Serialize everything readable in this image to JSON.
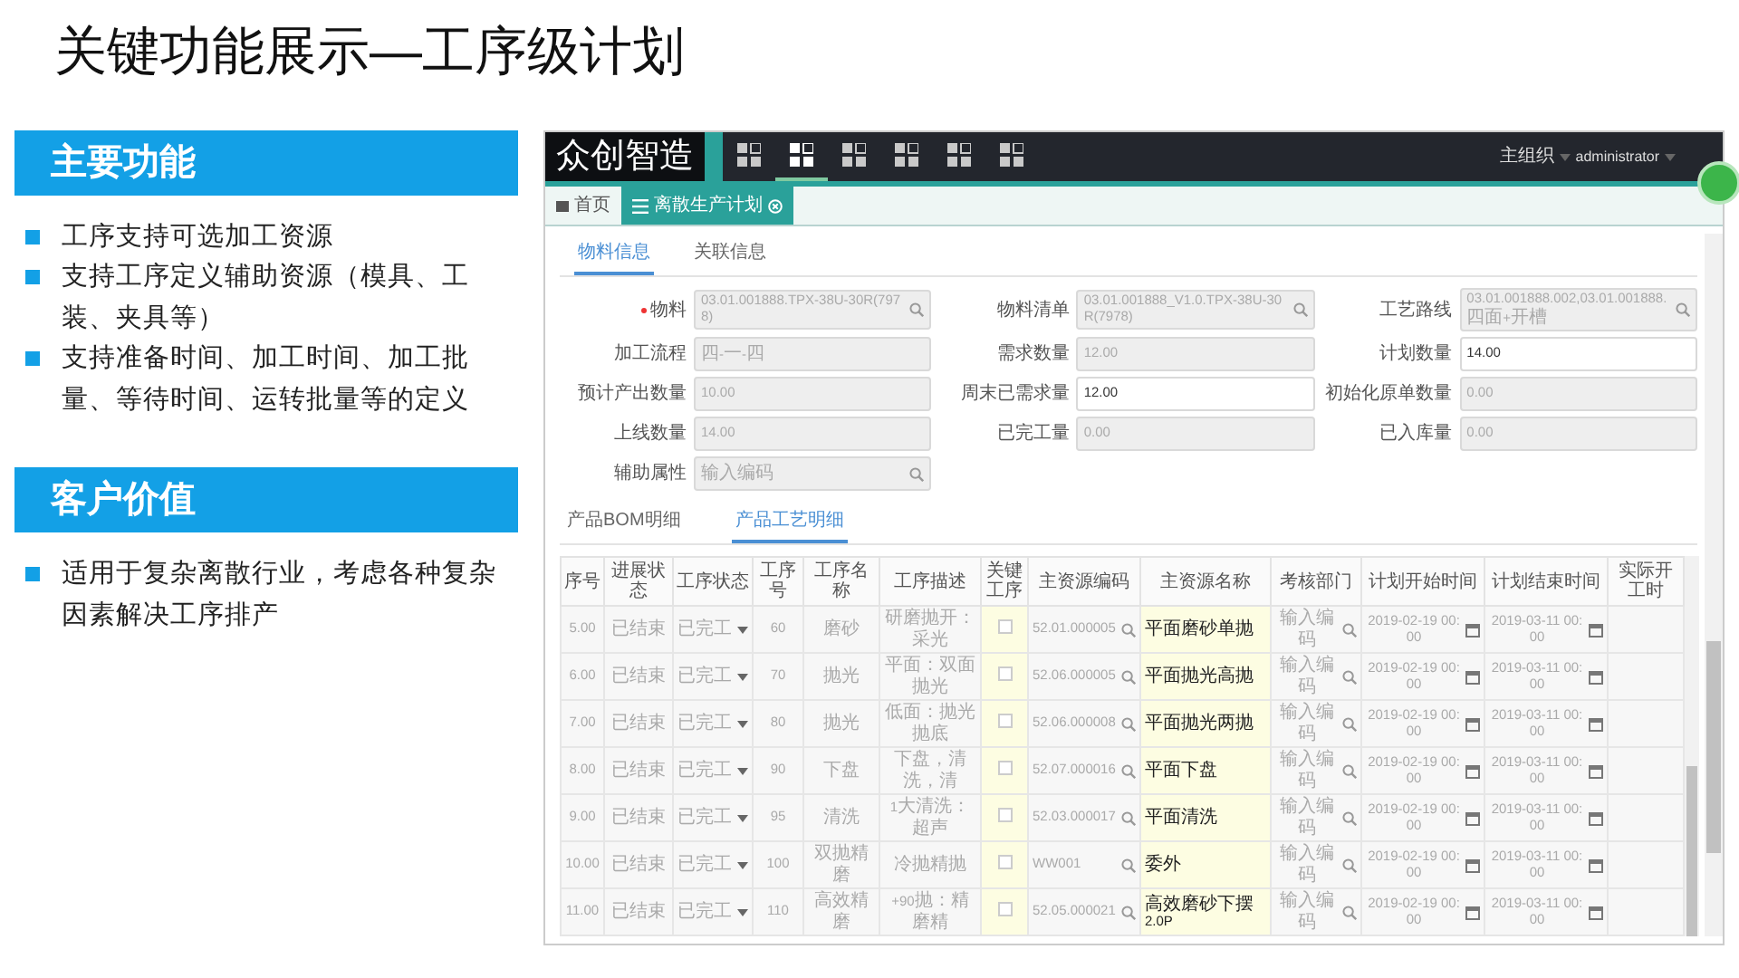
{
  "slide_title": "关键功能展示—工序级计划",
  "sections": [
    {
      "heading": "主要功能",
      "items": [
        "工序支持可选加工资源",
        "支持工序定义辅助资源（模具、工装、夹具等）",
        "支持准备时间、加工时间、加工批量、等待时间、运转批量等的定义"
      ]
    },
    {
      "heading": "客户价值",
      "items": [
        "适用于复杂离散行业，考虑各种复杂因素解决工序排产"
      ]
    }
  ],
  "app": {
    "logo": "众创智造",
    "nav_icons": [
      {
        "selected": false
      },
      {
        "selected": true
      },
      {
        "selected": false
      },
      {
        "selected": false
      },
      {
        "selected": false
      },
      {
        "selected": false
      }
    ],
    "org": "主组织",
    "user": "administrator",
    "tabs": [
      {
        "label": "首页",
        "kind": "home",
        "selected": false
      },
      {
        "label": "离散生产计划",
        "kind": "menu",
        "selected": true
      }
    ],
    "detail_tabs": [
      {
        "label": "物料信息",
        "selected": true
      },
      {
        "label": "关联信息",
        "selected": false
      }
    ],
    "form_rows": [
      [
        {
          "label": "物料",
          "required": true,
          "value": "03.01.001888.TPX-38U-30R(7978)",
          "readonly": true,
          "lookup": true
        },
        {
          "label": "物料清单",
          "required": false,
          "value": "03.01.001888_V1.0.TPX-38U-30R(7978)",
          "readonly": true,
          "lookup": true
        },
        {
          "label": "工艺路线",
          "required": false,
          "value": "03.01.001888.002,03.01.001888.四面+开槽",
          "readonly": true,
          "lookup": true
        }
      ],
      [
        {
          "label": "加工流程",
          "required": false,
          "value": "四-一-四",
          "readonly": true,
          "lookup": false
        },
        {
          "label": "需求数量",
          "required": false,
          "value": "12.00",
          "readonly": true,
          "lookup": false
        },
        {
          "label": "计划数量",
          "required": false,
          "value": "14.00",
          "readonly": false,
          "lookup": false
        }
      ],
      [
        {
          "label": "预计产出数量",
          "required": false,
          "value": "10.00",
          "readonly": true,
          "lookup": false
        },
        {
          "label": "周末已需求量",
          "required": false,
          "value": "12.00",
          "readonly": false,
          "lookup": false
        },
        {
          "label": "初始化原单数量",
          "required": false,
          "value": "0.00",
          "readonly": true,
          "lookup": false
        }
      ],
      [
        {
          "label": "上线数量",
          "required": false,
          "value": "14.00",
          "readonly": true,
          "lookup": false
        },
        {
          "label": "已完工量",
          "required": false,
          "value": "0.00",
          "readonly": true,
          "lookup": false
        },
        {
          "label": "已入库量",
          "required": false,
          "value": "0.00",
          "readonly": true,
          "lookup": false
        }
      ],
      [
        {
          "label": "辅助属性",
          "required": false,
          "placeholder": "输入编码",
          "readonly": true,
          "lookup": true
        }
      ]
    ],
    "table_tabs": [
      {
        "label": "产品BOM明细",
        "selected": false
      },
      {
        "label": "产品工艺明细",
        "selected": true
      }
    ],
    "table": {
      "columns": [
        "序号",
        "进展状态",
        "工序状态",
        "工序号",
        "工序名称",
        "工序描述",
        "关键工序",
        "主资源编码",
        "主资源名称",
        "考核部门",
        "计划开始时间",
        "计划结束时间",
        "实际开工时"
      ],
      "rows": [
        {
          "seq": "5.00",
          "progress": "已结束",
          "status": "已完工",
          "op_no": "60",
          "op_name": "磨砂",
          "op_desc": "研磨抛开：采光",
          "key_process": false,
          "resource_code": "52.01.000005",
          "resource_name": "平面磨砂单抛",
          "dept_placeholder": "输入编码",
          "plan_start": "2019-02-19 00:00",
          "plan_end": "2019-03-11 00:00"
        },
        {
          "seq": "6.00",
          "progress": "已结束",
          "status": "已完工",
          "op_no": "70",
          "op_name": "抛光",
          "op_desc": "平面：双面抛光",
          "key_process": false,
          "resource_code": "52.06.000005",
          "resource_name": "平面抛光高抛",
          "dept_placeholder": "输入编码",
          "plan_start": "2019-02-19 00:00",
          "plan_end": "2019-03-11 00:00"
        },
        {
          "seq": "7.00",
          "progress": "已结束",
          "status": "已完工",
          "op_no": "80",
          "op_name": "抛光",
          "op_desc": "低面：抛光抛底",
          "key_process": false,
          "resource_code": "52.06.000008",
          "resource_name": "平面抛光两抛",
          "dept_placeholder": "输入编码",
          "plan_start": "2019-02-19 00:00",
          "plan_end": "2019-03-11 00:00"
        },
        {
          "seq": "8.00",
          "progress": "已结束",
          "status": "已完工",
          "op_no": "90",
          "op_name": "下盘",
          "op_desc": "下盘，清洗，清",
          "key_process": false,
          "resource_code": "52.07.000016",
          "resource_name": "平面下盘",
          "dept_placeholder": "输入编码",
          "plan_start": "2019-02-19 00:00",
          "plan_end": "2019-03-11 00:00"
        },
        {
          "seq": "9.00",
          "progress": "已结束",
          "status": "已完工",
          "op_no": "95",
          "op_name": "清洗",
          "op_desc": "1大清洗：超声",
          "key_process": false,
          "resource_code": "52.03.000017",
          "resource_name": "平面清洗",
          "dept_placeholder": "输入编码",
          "plan_start": "2019-02-19 00:00",
          "plan_end": "2019-03-11 00:00"
        },
        {
          "seq": "10.00",
          "progress": "已结束",
          "status": "已完工",
          "op_no": "100",
          "op_name": "双抛精磨",
          "op_desc": "冷抛精抛",
          "key_process": false,
          "resource_code": "WW001",
          "resource_name": "委外",
          "dept_placeholder": "输入编码",
          "plan_start": "2019-02-19 00:00",
          "plan_end": "2019-03-11 00:00"
        },
        {
          "seq": "11.00",
          "progress": "已结束",
          "status": "已完工",
          "op_no": "110",
          "op_name": "高效精磨",
          "op_desc": "+90抛：精磨精",
          "key_process": false,
          "resource_code": "52.05.000021",
          "resource_name": "高效磨砂下摆2.0P",
          "dept_placeholder": "输入编码",
          "plan_start": "2019-02-19 00:00",
          "plan_end": "2019-03-11 00:00"
        }
      ]
    }
  }
}
